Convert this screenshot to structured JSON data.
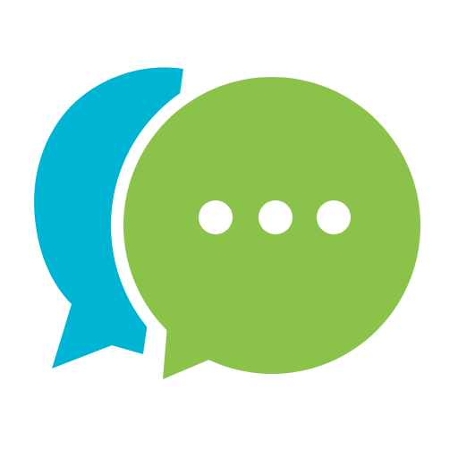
{
  "icon": {
    "name": "chat-bubbles-icon",
    "back_bubble": {
      "icon_name": "speech-bubble-icon",
      "color": "#00B5D3"
    },
    "front_bubble": {
      "icon_name": "speech-bubble-icon",
      "color": "#8BC34A"
    },
    "typing_indicator": {
      "icon_name": "ellipsis-icon",
      "dot_count": 3,
      "color": "#FFFFFF"
    },
    "gap_color": "#FFFFFF"
  }
}
